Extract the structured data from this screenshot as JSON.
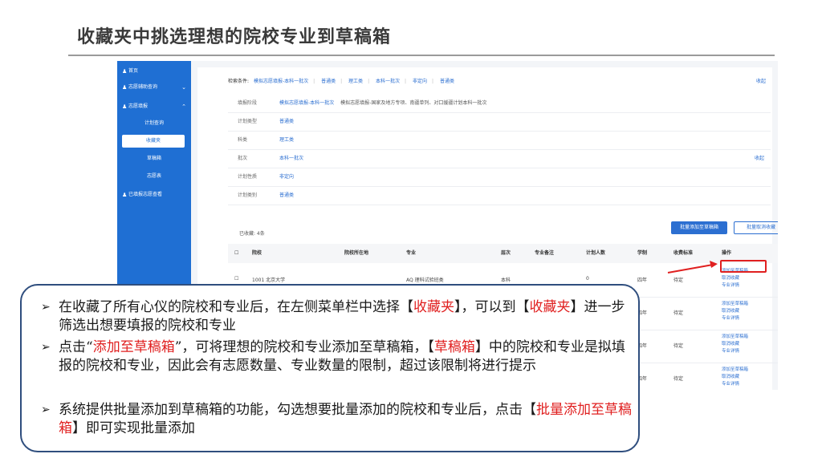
{
  "slide": {
    "title": "收藏夹中挑选理想的院校专业到草稿箱"
  },
  "sidebar": {
    "items": [
      {
        "label": "首页",
        "icon": "person-icon"
      },
      {
        "label": "志愿辅助查询",
        "icon": "person-icon",
        "chevron": "⌄"
      },
      {
        "label": "志愿填报",
        "icon": "person-icon",
        "chevron": "⌃"
      },
      {
        "label": "已填报志愿查看",
        "icon": "person-icon"
      }
    ],
    "sub_items": [
      "计划查询",
      "收藏夹",
      "草稿箱",
      "志愿表"
    ],
    "active_sub": "收藏夹"
  },
  "filters": {
    "cond_label": "检索条件:",
    "cond_values": [
      "模拟志愿填报-本科一批次",
      "普通类",
      "理工类",
      "本科一批次",
      "非定向",
      "普通类"
    ],
    "collapse": "收起",
    "rows": [
      {
        "key": "填报阶段",
        "value": "模拟志愿填报-本科一批次",
        "extra": "模拟志愿填报-国家及地方专项、南疆单列、对口援疆计划本科一批次"
      },
      {
        "key": "计划类型",
        "value": "普通类"
      },
      {
        "key": "科类",
        "value": "理工类"
      },
      {
        "key": "批次",
        "value": "本科一批次",
        "collapse": "收起"
      },
      {
        "key": "计划性质",
        "value": "非定向"
      },
      {
        "key": "计划类别",
        "value": "普通类"
      }
    ]
  },
  "toolbar": {
    "saved_count": "已收藏: 4条",
    "batch_add": "批量添加至草稿箱",
    "batch_cancel": "批量取消收藏"
  },
  "table": {
    "checkbox": "☐",
    "headers": [
      "院校",
      "院校所在地",
      "专业",
      "层次",
      "专业备注",
      "计划人数",
      "学制",
      "收费标准",
      "操作"
    ],
    "rows": [
      {
        "school": "1001 北京大学",
        "major": "AQ 理科试验班类",
        "level": "本科",
        "plan": "0",
        "years": "四年",
        "fee": "待定"
      },
      {
        "years": "四年",
        "fee": "待定"
      },
      {
        "years": "四年",
        "fee": "待定"
      },
      {
        "years": "四年",
        "fee": "待定"
      }
    ],
    "ops": [
      "添加至草稿箱",
      "取消收藏",
      "专业详情"
    ]
  },
  "callout": {
    "b1_a": "在收藏了所有心仪的院校和专业后，在左侧菜单栏中选择【",
    "b1_r1": "收藏夹",
    "b1_b": "】，可以到【",
    "b1_r2": "收藏夹",
    "b1_c": "】进一步筛选出想要填报的院校和专业",
    "b2_a": "点击“",
    "b2_r1": "添加至草稿箱",
    "b2_b": "”，可将理想的院校和专业添加至草稿箱，【",
    "b2_r2": "草稿箱",
    "b2_c": "】中的院校和专业是拟填报的院校和专业，因此会有志愿数量、专业数量的限制，超过该限制将进行提示",
    "b3_a": "系统提供批量添加到草稿箱的功能，勾选想要批量添加的院校和专业后，点击【",
    "b3_r1": "批量添加至草稿箱",
    "b3_b": "】即可实现批量添加",
    "marker": "➢"
  },
  "colors": {
    "sidebar_bg": "#1f6fd3",
    "link_blue": "#2c6fd1",
    "highlight_red": "#e02020",
    "callout_border": "#2f4e7e"
  }
}
